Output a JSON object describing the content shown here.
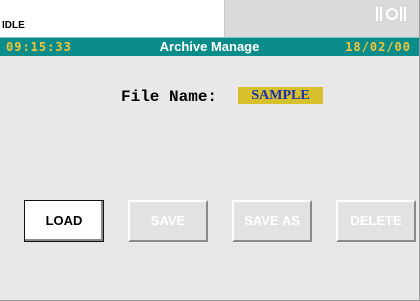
{
  "status": {
    "text": "IDLE"
  },
  "header": {
    "time": "09:15:33",
    "title": "Archive Manage",
    "date": "18/02/00"
  },
  "file": {
    "label": "File Name:",
    "value": "SAMPLE"
  },
  "buttons": {
    "load": "LOAD",
    "save": "SAVE",
    "save_as": "SAVE AS",
    "delete": "DELETE"
  },
  "colors": {
    "title_bar": "#0a8c8a",
    "clock_text": "#f2c53a",
    "file_value_bg": "#d6c02c",
    "file_value_text": "#1a2fae"
  },
  "icons": {
    "logo": "signal-bars-logo-icon"
  }
}
